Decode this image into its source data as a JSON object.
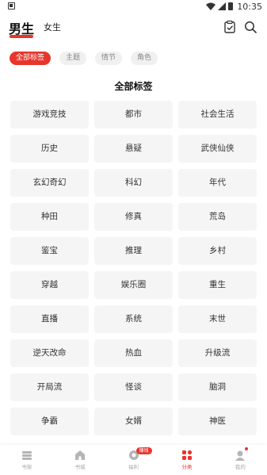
{
  "status_bar": {
    "time": "10:35",
    "icons": [
      "notification-icon",
      "wifi-icon",
      "signal-icon",
      "battery-icon"
    ]
  },
  "header": {
    "tab_male": "男生",
    "tab_female": "女生",
    "active_tab": "男生",
    "icons": [
      "checkin-icon",
      "search-icon"
    ]
  },
  "filters": [
    {
      "label": "全部标签",
      "active": true
    },
    {
      "label": "主题",
      "active": false
    },
    {
      "label": "情节",
      "active": false
    },
    {
      "label": "角色",
      "active": false
    }
  ],
  "section": {
    "title": "全部标签"
  },
  "tags": [
    "游戏竞技",
    "都市",
    "社会生活",
    "历史",
    "悬疑",
    "武侠仙侠",
    "玄幻奇幻",
    "科幻",
    "年代",
    "种田",
    "修真",
    "荒岛",
    "鉴宝",
    "推理",
    "乡村",
    "穿越",
    "娱乐圈",
    "重生",
    "直播",
    "系统",
    "末世",
    "逆天改命",
    "热血",
    "升级流",
    "开局流",
    "怪谈",
    "脑洞",
    "争霸",
    "女婿",
    "神医"
  ],
  "bottom_nav": [
    {
      "label": "书架",
      "icon": "bookshelf-icon",
      "active": false
    },
    {
      "label": "书城",
      "icon": "bookstore-icon",
      "active": false
    },
    {
      "label": "福利",
      "icon": "welfare-icon",
      "active": false,
      "badge": "赚钱"
    },
    {
      "label": "分类",
      "icon": "category-icon",
      "active": true
    },
    {
      "label": "我的",
      "icon": "profile-icon",
      "active": false,
      "dot": true
    }
  ],
  "colors": {
    "accent": "#e8352c",
    "tag_bg": "#f5f5f5",
    "chip_bg": "#f0f0f0"
  }
}
